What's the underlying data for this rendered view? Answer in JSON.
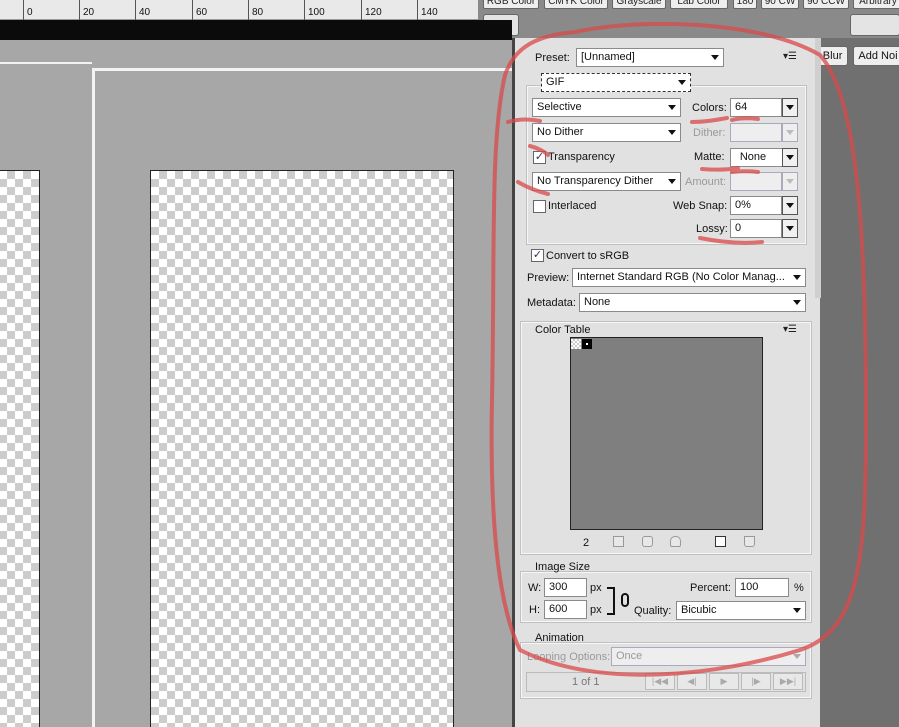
{
  "ruler": {
    "labels": [
      "0",
      "20",
      "40",
      "60",
      "80",
      "100",
      "120",
      "140"
    ]
  },
  "top_buttons": [
    "RGB Color",
    "CMYK Color",
    "Grayscale",
    "Lab Color",
    "180",
    "90 CW",
    "90 CCW",
    "Arbitrary"
  ],
  "filter_buttons": [
    "n Blur",
    "Add Noi"
  ],
  "preset": {
    "label": "Preset:",
    "value": "[Unnamed]"
  },
  "format": {
    "value": "GIF"
  },
  "reduction": {
    "value": "Selective"
  },
  "colors": {
    "label": "Colors:",
    "value": "64"
  },
  "dither_algo": {
    "value": "No Dither"
  },
  "dither": {
    "label": "Dither:",
    "value": ""
  },
  "transparency": {
    "label": "Transparency",
    "checked": true
  },
  "matte": {
    "label": "Matte:",
    "value": "None"
  },
  "trans_dither": {
    "value": "No Transparency Dither"
  },
  "amount": {
    "label": "Amount:",
    "value": ""
  },
  "interlaced": {
    "label": "Interlaced",
    "checked": false
  },
  "web_snap": {
    "label": "Web Snap:",
    "value": "0%"
  },
  "lossy": {
    "label": "Lossy:",
    "value": "0"
  },
  "convert_srgb": {
    "label": "Convert to sRGB",
    "checked": true
  },
  "preview": {
    "label": "Preview:",
    "value": "Internet Standard RGB (No Color Manag..."
  },
  "metadata": {
    "label": "Metadata:",
    "value": "None"
  },
  "color_table": {
    "title": "Color Table",
    "count": "2",
    "swatches": [
      "#ffffff",
      "#000000"
    ]
  },
  "image_size": {
    "title": "Image Size",
    "w_label": "W:",
    "w_value": "300",
    "h_label": "H:",
    "h_value": "600",
    "unit": "px",
    "percent_label": "Percent:",
    "percent_value": "100",
    "percent_unit": "%",
    "quality_label": "Quality:",
    "quality_value": "Bicubic"
  },
  "animation": {
    "title": "Animation",
    "looping_label": "Looping Options:",
    "looping_value": "Once",
    "frame_counter": "1 of 1"
  },
  "colors_theme": {
    "annotation": "#d94a4a",
    "panel": "#e1e1e1",
    "canvas_bg": "#a7a7a7"
  }
}
